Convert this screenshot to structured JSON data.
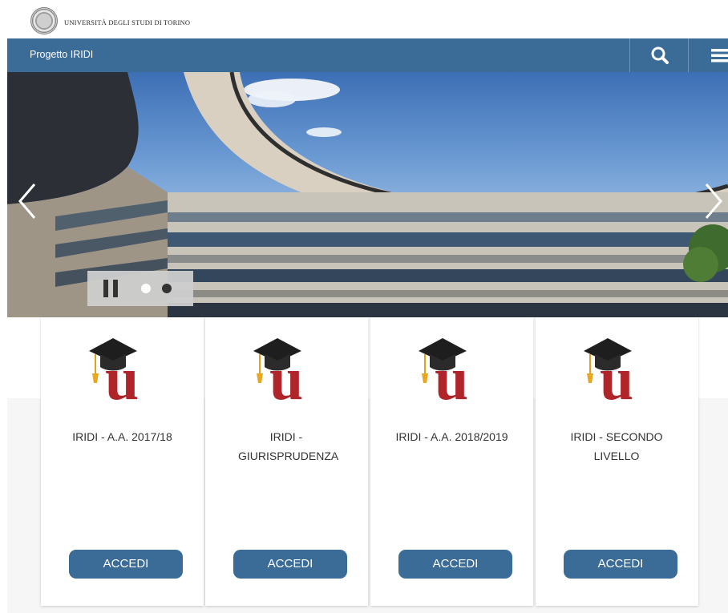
{
  "header": {
    "university": "UNIVERSITÀ DEGLI STUDI DI TORINO",
    "seal_icon": "university-seal-icon"
  },
  "navbar": {
    "title": "Progetto IRIDI",
    "search_icon": "search-icon",
    "menu_icon": "hamburger-menu-icon"
  },
  "carousel": {
    "prev_icon": "chevron-left-icon",
    "next_icon": "chevron-right-icon",
    "pause_icon": "pause-icon",
    "slides": 2,
    "active_slide": 1
  },
  "cards": [
    {
      "title": "IRIDI - A.A. 2017/18",
      "button": "ACCEDI"
    },
    {
      "title": "IRIDI - GIURISPRUDENZA",
      "button": "ACCEDI"
    },
    {
      "title": "IRIDI - A.A. 2018/2019",
      "button": "ACCEDI"
    },
    {
      "title": "IRIDI - SECONDO LIVELLO",
      "button": "ACCEDI"
    }
  ],
  "colors": {
    "brand_blue": "#3b6b97",
    "logo_red": "#b0252a"
  }
}
